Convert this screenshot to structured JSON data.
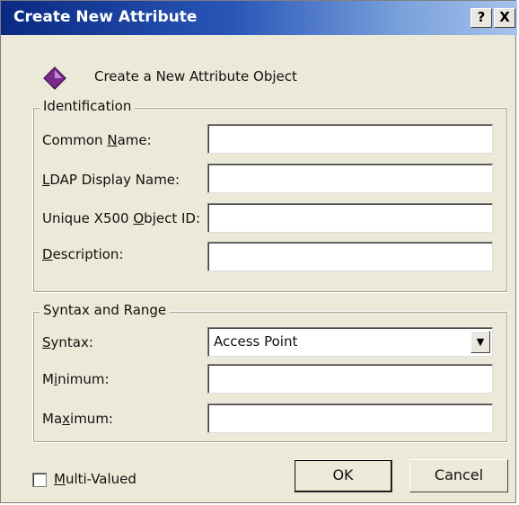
{
  "window": {
    "title": "Create New Attribute",
    "help_label": "?",
    "close_label": "X"
  },
  "header": {
    "icon": "attribute-diamond-icon",
    "text": "Create a New Attribute Object"
  },
  "identification": {
    "group_title": "Identification",
    "common_name": {
      "pre": "Common ",
      "accel": "N",
      "post": "ame:",
      "value": ""
    },
    "ldap_display_name": {
      "pre": "",
      "accel": "L",
      "post": "DAP Display Name:",
      "value": ""
    },
    "unique_x500_oid": {
      "pre": "Unique X500 ",
      "accel": "O",
      "post": "bject ID:",
      "value": ""
    },
    "description": {
      "pre": "",
      "accel": "D",
      "post": "escription:",
      "value": ""
    }
  },
  "syntax_range": {
    "group_title": "Syntax and Range",
    "syntax": {
      "pre": "",
      "accel": "S",
      "post": "yntax:",
      "value": "Access Point"
    },
    "minimum": {
      "pre": "M",
      "accel": "i",
      "post": "nimum:",
      "value": ""
    },
    "maximum": {
      "pre": "Ma",
      "accel": "x",
      "post": "imum:",
      "value": ""
    }
  },
  "multi_valued": {
    "pre": "",
    "accel": "M",
    "post": "ulti-Valued",
    "checked": false
  },
  "buttons": {
    "ok": "OK",
    "cancel": "Cancel"
  },
  "colors": {
    "dialog_bg": "#ece9d8",
    "titlebar_start": "#0a2a82",
    "titlebar_end": "#a7c3ea",
    "icon_purple": "#7b2a8c"
  }
}
